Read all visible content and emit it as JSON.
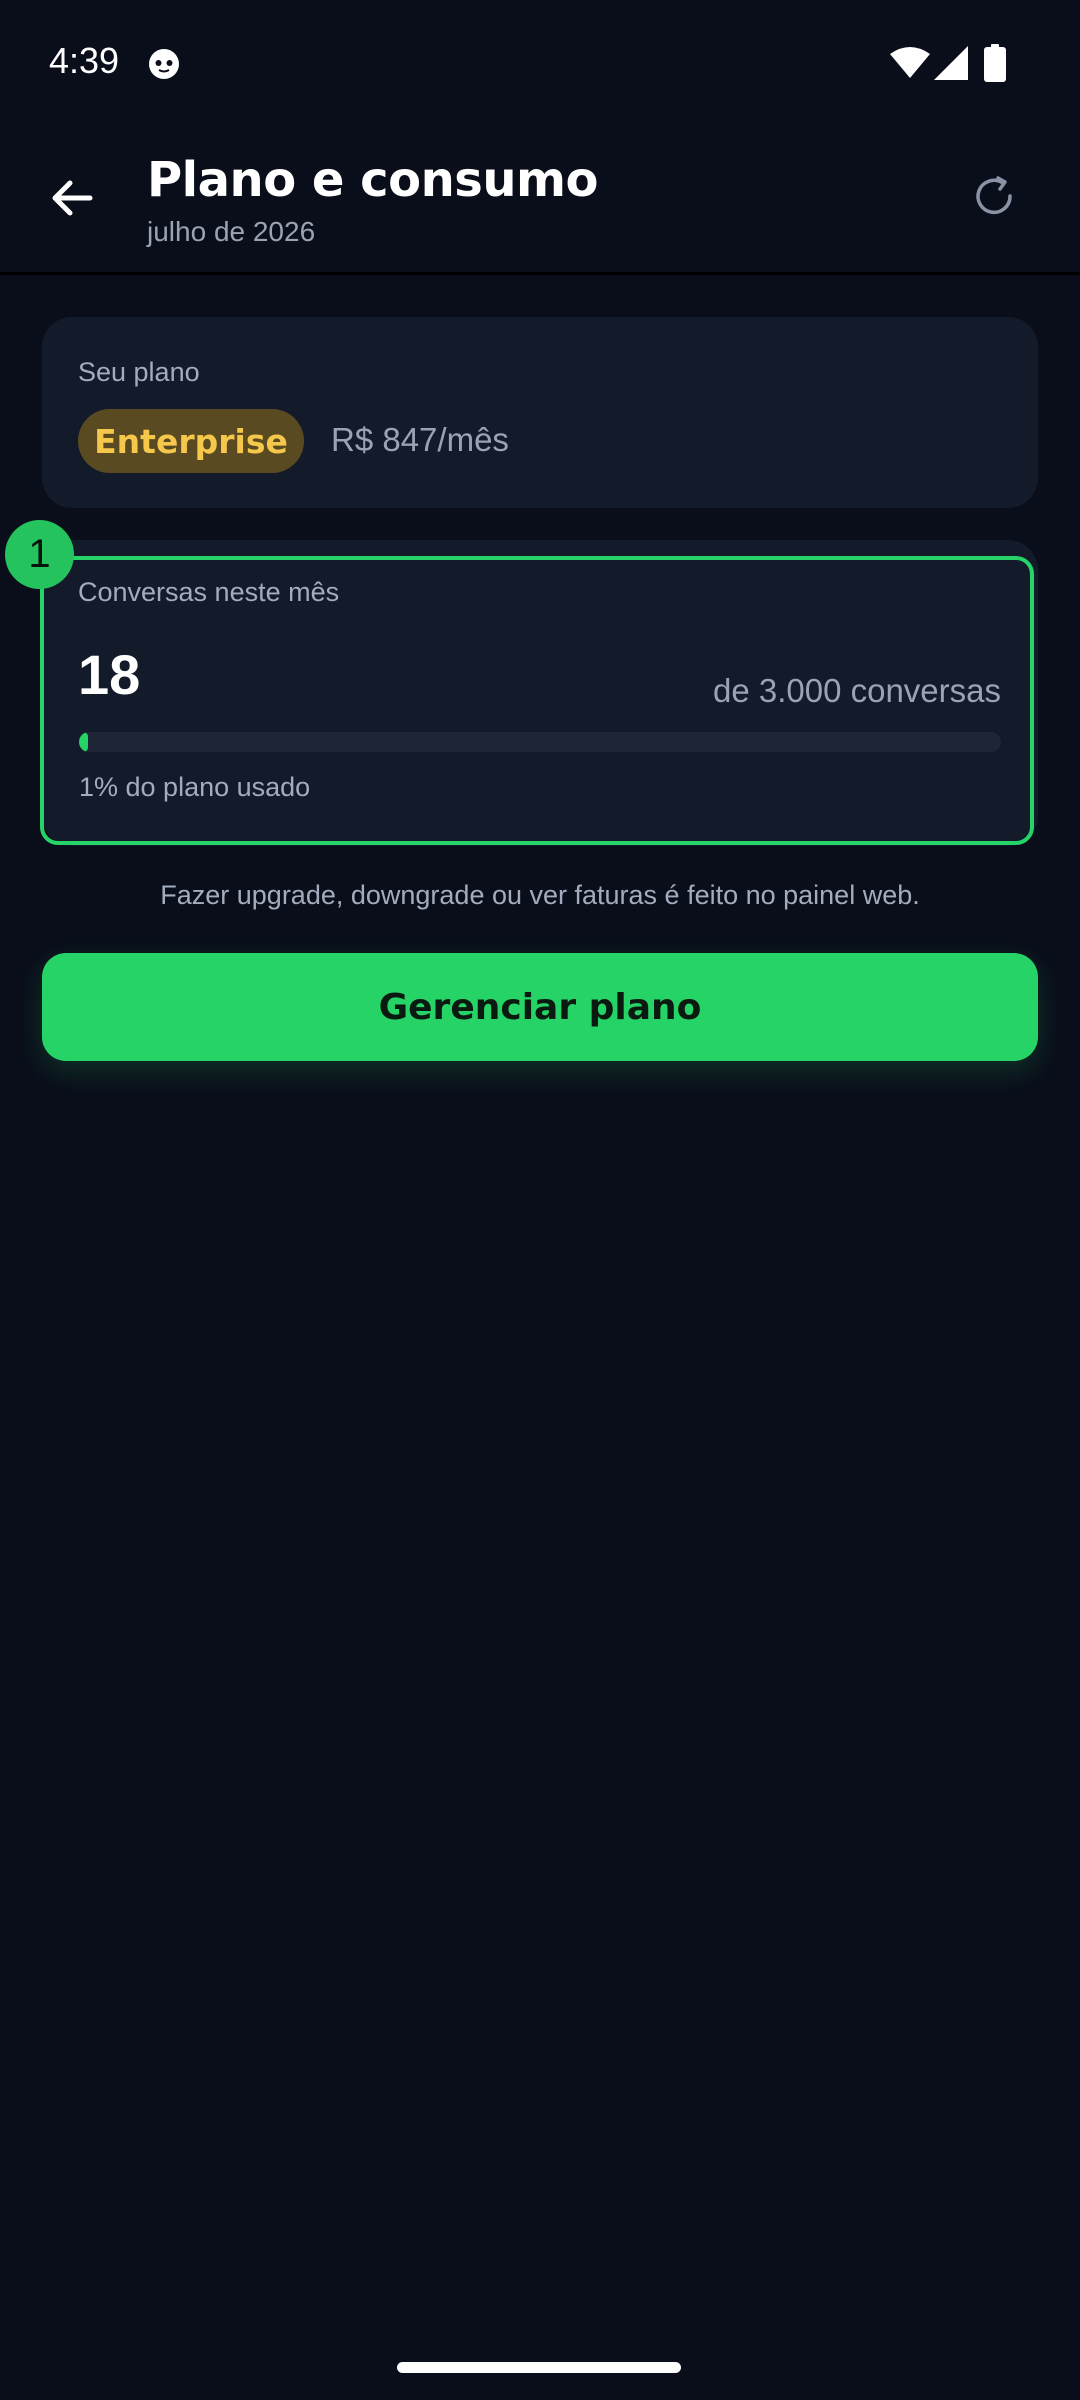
{
  "status_bar": {
    "time": "4:39",
    "icons": [
      "app-notification-icon",
      "wifi-icon",
      "cellular-signal-icon",
      "battery-icon"
    ]
  },
  "header": {
    "title": "Plano e consumo",
    "subtitle": "julho de 2026",
    "back_icon": "arrow-left-icon",
    "refresh_icon": "refresh-icon"
  },
  "plan": {
    "label": "Seu plano",
    "name": "Enterprise",
    "price": "R$ 847/mês"
  },
  "usage": {
    "marker": "1",
    "label": "Conversas neste mês",
    "value": "18",
    "limit_text": "de 3.000 conversas",
    "used_fraction": 0.01,
    "percent_text": "1% do plano usado"
  },
  "hint": "Fazer upgrade, downgrade ou ver faturas é feito no painel web.",
  "manage_button": "Gerenciar plano",
  "colors": {
    "background": "#0a0e1a",
    "card": "#131a2a",
    "accent": "#25d366",
    "badge_bg": "#5a4a22",
    "badge_text": "#f5c84c"
  }
}
